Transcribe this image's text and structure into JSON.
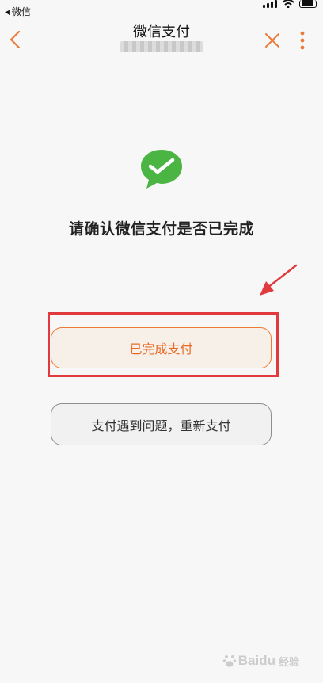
{
  "status_bar": {
    "back_label": "微信",
    "back_glyph": "◀"
  },
  "nav": {
    "title": "微信支付"
  },
  "content": {
    "heading": "请确认微信支付是否已完成"
  },
  "buttons": {
    "completed": "已完成支付",
    "retry": "支付遇到问题，重新支付"
  },
  "watermark": {
    "brand": "Baidu",
    "sub": "经验"
  },
  "colors": {
    "accent": "#ea6a26",
    "wechat_green": "#4bb543",
    "annotation_red": "#e03a3f"
  },
  "icons": {
    "back": "chevron-left-icon",
    "close": "close-icon",
    "more": "more-vertical-icon",
    "logo": "wechat-pay-icon"
  }
}
